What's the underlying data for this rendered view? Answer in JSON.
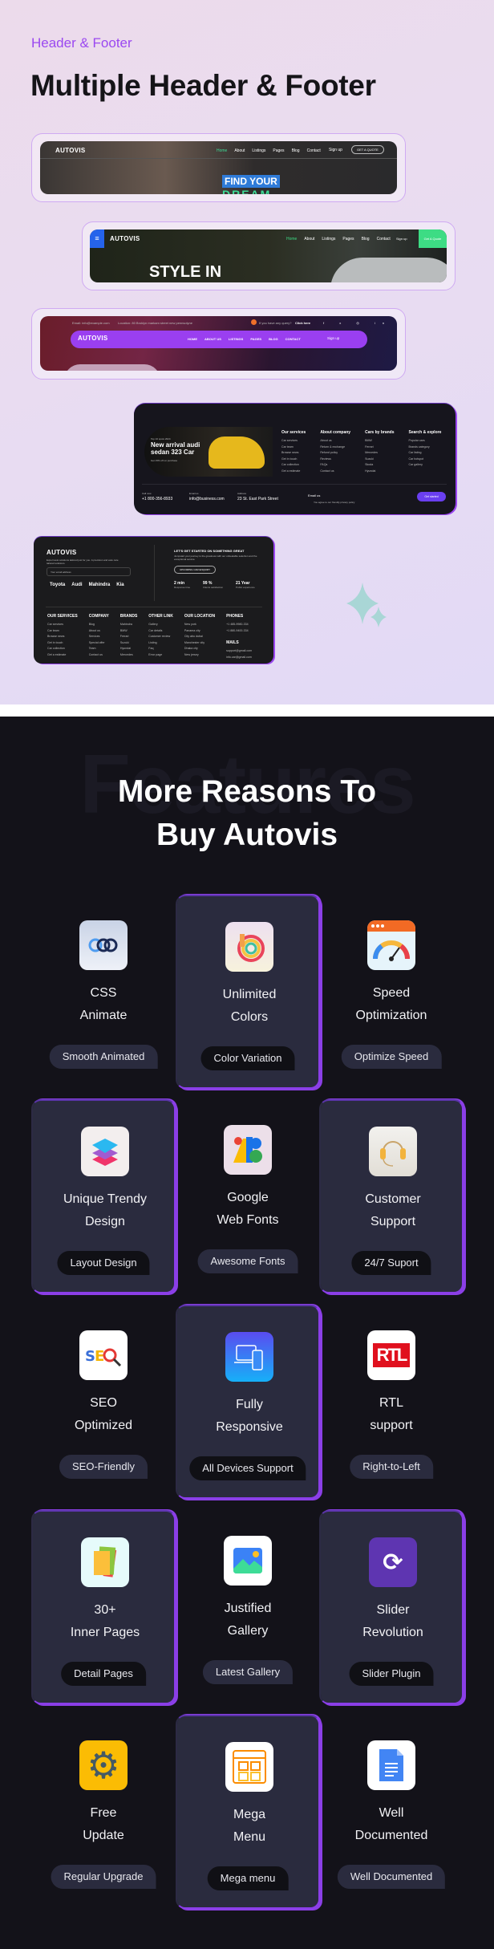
{
  "header": {
    "kicker": "Header & Footer",
    "title": "Multiple Header & Footer"
  },
  "previews": {
    "header1": {
      "logo": "AUTOVIS",
      "nav": [
        "Home",
        "About",
        "Listings",
        "Pages",
        "Blog",
        "Contact"
      ],
      "signup": "Sign up",
      "cta": "GET A QUOTE",
      "hero": "FIND YOUR",
      "hero2": "DREAM",
      "accent": "#3ddc97"
    },
    "header2": {
      "logo": "AUTOVIS",
      "nav": [
        "Home",
        "About",
        "Listings",
        "Pages",
        "Blog",
        "Contact"
      ],
      "signup": "Sign up",
      "cta": "Get A Quote",
      "hero": "STYLE IN",
      "accent": "#3ddc84"
    },
    "header3": {
      "email": "Email: info@example.com",
      "location": "Location: 80 Broklyn markam street new pennsolyne",
      "query": "If you have any query?",
      "click": "Click here",
      "logo": "AUTOVIS",
      "nav": [
        "HOME",
        "ABOUT US",
        "LISTINGS",
        "PAGES",
        "BLOG",
        "CONTACT"
      ],
      "signup": "Sign up",
      "accent": "#9a3ff0"
    },
    "footer1": {
      "promo_small": "Top 10 spots 2024",
      "promo": "New arrival audi sedan 323 Car",
      "promo_sub": "Get 15% off on purchase",
      "columns": [
        {
          "title": "Our services",
          "items": [
            "Car services",
            "Car team",
            "Browse news",
            "Get in touch",
            "Car collection",
            "Get a estimate"
          ]
        },
        {
          "title": "About company",
          "items": [
            "About us",
            "Return & exchange",
            "Refund policy",
            "Reviews",
            "FAQs",
            "Contact us"
          ]
        },
        {
          "title": "Cars by brands",
          "items": [
            "BMW",
            "Ferrari",
            "Mercedes",
            "Suzuki",
            "Skoda",
            "Hyundai"
          ]
        },
        {
          "title": "Search & explore",
          "items": [
            "Popular cars",
            "Brands category",
            "Car listing",
            "Car hotspot",
            "Car gallery"
          ]
        }
      ],
      "call_label": "Call now",
      "phone": "+1 800-356-8933",
      "email_label": "Email us",
      "email": "info@business.com",
      "address_label": "Address",
      "address": "23 St. East Park Street",
      "newsletter_label": "Email us",
      "agree": "You agree to our friendly privacy policy",
      "button": "Get started"
    },
    "footer2": {
      "logo": "AUTOVIS",
      "desc": "Expert auto solutions tailored just for you. A precision and auto care tailored solutions.",
      "email_placeholder": "Your email address",
      "brands": [
        "Toyota",
        "Audi",
        "Mahindra",
        "Kia"
      ],
      "cta_title": "LET'S GET STARTED ON SOMETHING GREAT",
      "cta_desc": "Jumpstart your journey to the greatness with our unbeatable selection and the exceptional service.",
      "cta_button": "UPCOMING CAR ENQUIRY",
      "stats": [
        {
          "value": "2 min",
          "label": "Response time"
        },
        {
          "value": "99 %",
          "label": "Clients satisfaction"
        },
        {
          "value": "21 Year",
          "label": "Public experience"
        }
      ],
      "columns": [
        {
          "title": "OUR SERVICES",
          "items": [
            "Car services",
            "Car team",
            "Browse news",
            "Get in touch",
            "Car collection",
            "Get a estimate"
          ]
        },
        {
          "title": "COMPANY",
          "items": [
            "Blog",
            "About us",
            "Services",
            "Special offer",
            "Team",
            "Contact us"
          ]
        },
        {
          "title": "BRANDS",
          "items": [
            "Mahindra",
            "BMW",
            "Ferrari",
            "Suzuki",
            "Hyundai",
            "Mercedes"
          ]
        },
        {
          "title": "OTHER LINK",
          "items": [
            "Gallery",
            "Car details",
            "Customer review",
            "Listing",
            "Faq",
            "Error page"
          ]
        },
        {
          "title": "OUR LOCATION",
          "items": [
            "New york",
            "Panama city",
            "City abu dubai",
            "Manchester city",
            "Dhaka city",
            "New jersey"
          ]
        },
        {
          "title": "PHONES",
          "items": [
            "+1 485-9980-334",
            "+1 880-9400-334"
          ]
        }
      ],
      "mails_title": "MAILS",
      "mails": [
        "support@gmail.com",
        "info.car@gmail.com"
      ]
    }
  },
  "features": {
    "watermark": "Features",
    "title_line1": "More Reasons To",
    "title_line2": "Buy Autovis",
    "accent": "#8a3ee8",
    "items": [
      {
        "line1": "CSS",
        "line2": "Animate",
        "pill": "Smooth Animated",
        "icon": "css-animate-icon",
        "highlight": false
      },
      {
        "line1": "Unlimited",
        "line2": "Colors",
        "pill": "Color Variation",
        "icon": "color-brush-icon",
        "highlight": true
      },
      {
        "line1": "Speed",
        "line2": "Optimization",
        "pill": "Optimize Speed",
        "icon": "speedometer-icon",
        "highlight": false
      },
      {
        "line1": "Unique Trendy",
        "line2": "Design",
        "pill": "Layout Design",
        "icon": "layers-icon",
        "highlight": true
      },
      {
        "line1": "Google",
        "line2": "Web Fonts",
        "pill": "Awesome Fonts",
        "icon": "google-fonts-icon",
        "highlight": false
      },
      {
        "line1": "Customer",
        "line2": "Support",
        "pill": "24/7 Suport",
        "icon": "headset-icon",
        "highlight": true
      },
      {
        "line1": "SEO",
        "line2": "Optimized",
        "pill": "SEO-Friendly",
        "icon": "seo-icon",
        "highlight": false
      },
      {
        "line1": "Fully",
        "line2": "Responsive",
        "pill": "All Devices Support",
        "icon": "devices-icon",
        "highlight": true
      },
      {
        "line1": "RTL",
        "line2": "support",
        "pill": "Right-to-Left",
        "icon": "rtl-icon",
        "highlight": false
      },
      {
        "line1": "30+",
        "line2": "Inner Pages",
        "pill": "Detail Pages",
        "icon": "pages-icon",
        "highlight": true
      },
      {
        "line1": "Justified",
        "line2": "Gallery",
        "pill": "Latest Gallery",
        "icon": "gallery-icon",
        "highlight": false
      },
      {
        "line1": "Slider",
        "line2": "Revolution",
        "pill": "Slider Plugin",
        "icon": "slider-refresh-icon",
        "highlight": true
      },
      {
        "line1": "Free",
        "line2": "Update",
        "pill": "Regular Upgrade",
        "icon": "gear-icon",
        "highlight": false
      },
      {
        "line1": "Mega",
        "line2": "Menu",
        "pill": "Mega menu",
        "icon": "mega-menu-icon",
        "highlight": true
      },
      {
        "line1": "Well",
        "line2": "Documented",
        "pill": "Well Documented",
        "icon": "document-icon",
        "highlight": false
      }
    ]
  }
}
